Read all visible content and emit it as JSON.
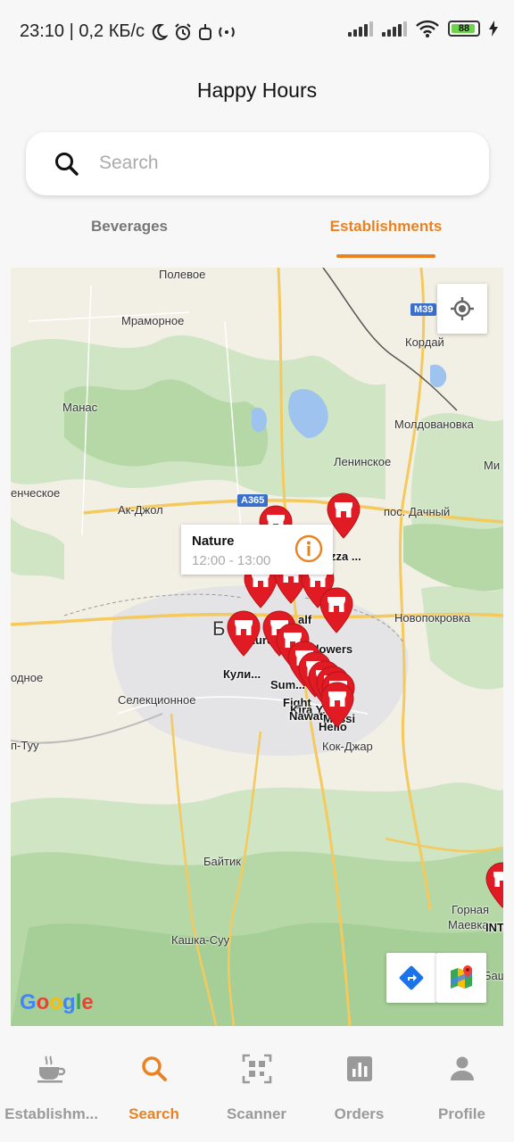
{
  "status_bar": {
    "left_text": "23:10 | 0,2 КБ/с",
    "battery": "88"
  },
  "header": {
    "title": "Happy Hours"
  },
  "search": {
    "placeholder": "Search",
    "value": ""
  },
  "tabs": [
    {
      "label": "Beverages",
      "active": false
    },
    {
      "label": "Establishments",
      "active": true
    }
  ],
  "map": {
    "place_labels": [
      "Полевое",
      "Мраморное",
      "Манас",
      "Кордай",
      "Молдовановка",
      "Ленинское",
      "Ми",
      "енческое",
      "Ак-Джол",
      "пос. Дачный",
      "Новопокровка",
      "одное",
      "Селекционное",
      "Б",
      "п-Туу",
      "Кок-Джар",
      "Байтик",
      "Горная",
      "Маевка",
      "Баш",
      "Кашка-Суу"
    ],
    "road_badges": [
      "М39",
      "А365"
    ],
    "pin_labels": [
      "zza ...",
      "Nature",
      "alf",
      "Flowers",
      "Кули...",
      "Sum...",
      "Fight",
      "Kira Y...",
      "Nawat",
      "Messi",
      "Hello",
      "INT"
    ],
    "info_window": {
      "name": "Nature",
      "hours": "12:00 - 13:00"
    },
    "google_logo": "Google"
  },
  "bottom_nav": [
    {
      "label": "Establishm...",
      "icon": "coffee-cup-icon",
      "active": false
    },
    {
      "label": "Search",
      "icon": "search-icon",
      "active": true
    },
    {
      "label": "Scanner",
      "icon": "qr-scanner-icon",
      "active": false
    },
    {
      "label": "Orders",
      "icon": "bar-chart-icon",
      "active": false
    },
    {
      "label": "Profile",
      "icon": "person-icon",
      "active": false
    }
  ],
  "colors": {
    "accent": "#ea8222",
    "pin_red": "#e01b24",
    "inactive": "#9a9a9a"
  }
}
